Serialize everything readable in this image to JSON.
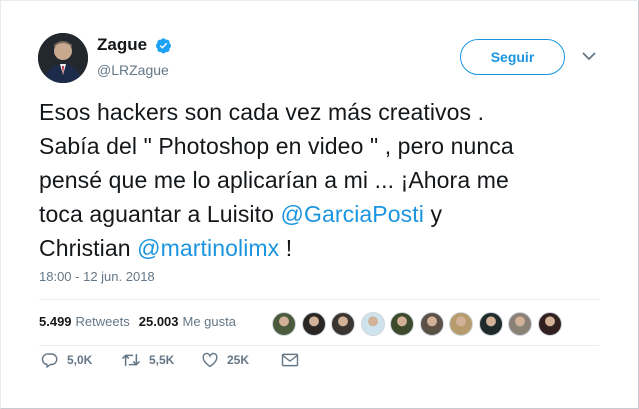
{
  "author": {
    "name": "Zague",
    "handle": "@LRZague",
    "verified": true
  },
  "follow_button": {
    "label": "Seguir"
  },
  "tweet": {
    "lines": [
      [
        {
          "text": "Esos hackers son cada vez más creativos ."
        }
      ],
      [
        {
          "text": "Sabía del \" Photoshop en video \" , pero nunca"
        }
      ],
      [
        {
          "text": "pensé que me lo aplicarían a mi ... ¡Ahora me"
        }
      ],
      [
        {
          "text": "toca aguantar a Luisito "
        },
        {
          "text": "@GarciaPosti",
          "mention": true
        },
        {
          "text": " y"
        }
      ],
      [
        {
          "text": "Christian "
        },
        {
          "text": "@martinolimx",
          "mention": true
        },
        {
          "text": " !"
        }
      ]
    ]
  },
  "timestamp": "18:00 - 12 jun. 2018",
  "stats": {
    "retweets_count": "5.499",
    "retweets_label": "Retweets",
    "likes_count": "25.003",
    "likes_label": "Me gusta"
  },
  "liker_avatars": [
    "#4b5a3d",
    "#2a2623",
    "#3b3532",
    "#cfe3ef",
    "#3d4a2b",
    "#5a5046",
    "#b59b6e",
    "#1f2a2a",
    "#8a8176",
    "#302020"
  ],
  "actions": {
    "reply_count": "5,0K",
    "retweet_count": "5,5K",
    "like_count": "25K"
  },
  "colors": {
    "accent": "#1b95e0",
    "text": "#14171a",
    "secondary": "#657786",
    "verified": "#1da1f2"
  }
}
